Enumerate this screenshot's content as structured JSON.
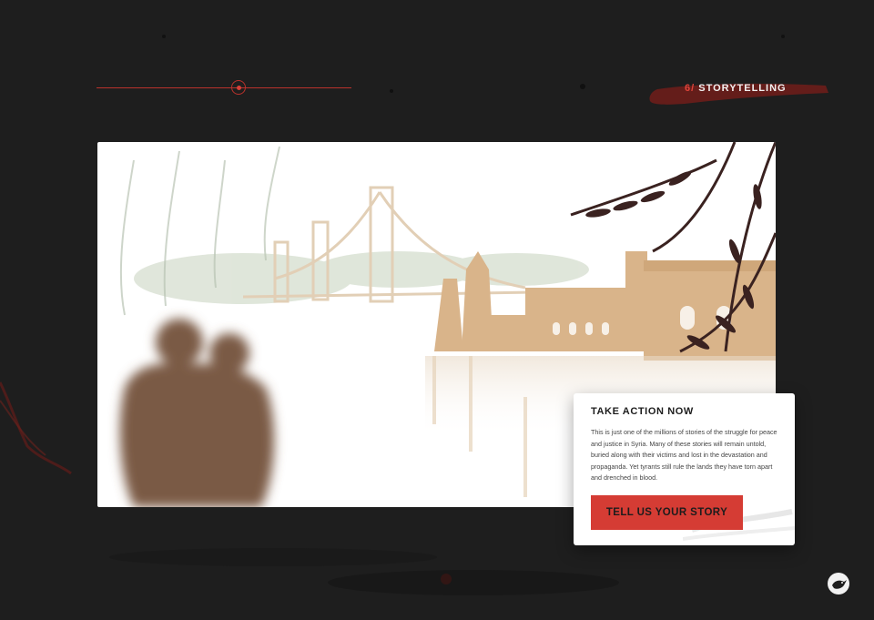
{
  "section": {
    "number": "6/",
    "title": "STORYTELLING"
  },
  "progress": {
    "current_step": 6
  },
  "card": {
    "heading": "TAKE ACTION NOW",
    "body": "This is just one of the millions of stories of the struggle for peace and justice in Syria. Many of these stories will remain untold, buried along with their victims and lost in the devastation and propaganda. Yet tyrants still rule the lands they have torn apart and drenched in blood.",
    "cta_label": "TELL US YOUR STORY"
  },
  "icons": {
    "progress_marker": "progress-dot-icon",
    "brand": "bird-logo-icon"
  },
  "colors": {
    "background": "#1e1e1e",
    "accent": "#d53c34",
    "illustration_tan": "#d9b48a",
    "silhouette": "#7a5a45"
  }
}
